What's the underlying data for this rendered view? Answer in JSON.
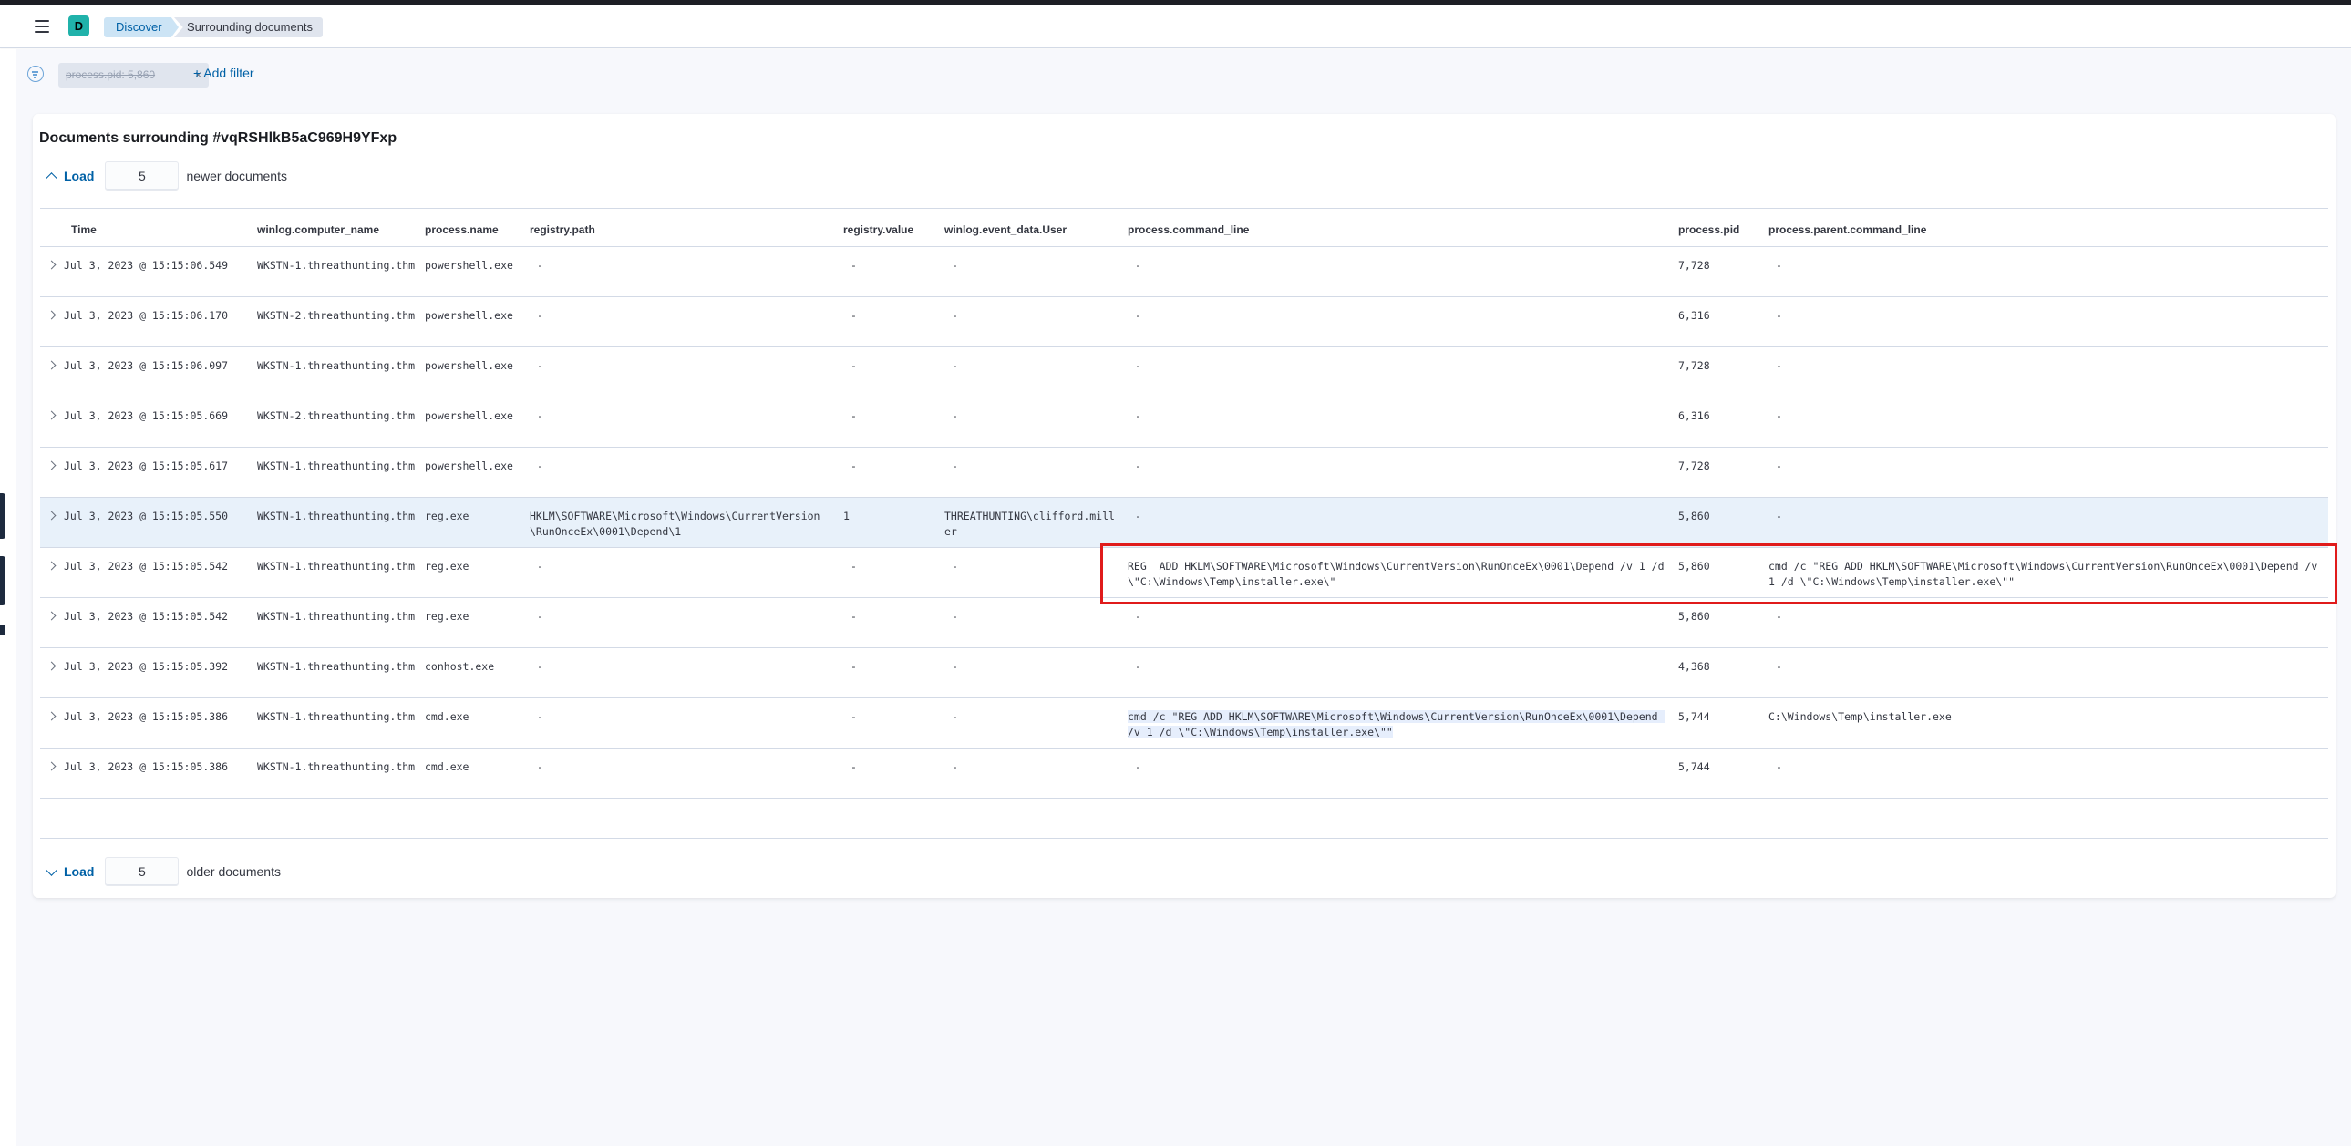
{
  "header": {
    "space_initial": "D",
    "breadcrumbs": [
      "Discover",
      "Surrounding documents"
    ]
  },
  "filters": {
    "pill": "process.pid: 5,860",
    "add_filter": "+ Add filter"
  },
  "panel": {
    "title": "Documents surrounding #vqRSHlkB5aC969H9YFxp",
    "newer": {
      "load": "Load",
      "count": "5",
      "label": "newer documents"
    },
    "older": {
      "load": "Load",
      "count": "5",
      "label": "older documents"
    }
  },
  "table": {
    "columns": [
      "Time",
      "winlog.computer_name",
      "process.name",
      "registry.path",
      "registry.value",
      "winlog.event_data.User",
      "process.command_line",
      "process.pid",
      "process.parent.command_line"
    ],
    "rows": [
      {
        "time": "Jul 3, 2023 @ 15:15:06.549",
        "computer": "WKSTN-1.threathunting.thm",
        "pname": "powershell.exe",
        "rpath": "-",
        "rvalue": "-",
        "user": "-",
        "cmd": "-",
        "pid": "7,728",
        "parent": "-"
      },
      {
        "time": "Jul 3, 2023 @ 15:15:06.170",
        "computer": "WKSTN-2.threathunting.thm",
        "pname": "powershell.exe",
        "rpath": "-",
        "rvalue": "-",
        "user": "-",
        "cmd": "-",
        "pid": "6,316",
        "parent": "-"
      },
      {
        "time": "Jul 3, 2023 @ 15:15:06.097",
        "computer": "WKSTN-1.threathunting.thm",
        "pname": "powershell.exe",
        "rpath": "-",
        "rvalue": "-",
        "user": "-",
        "cmd": "-",
        "pid": "7,728",
        "parent": "-"
      },
      {
        "time": "Jul 3, 2023 @ 15:15:05.669",
        "computer": "WKSTN-2.threathunting.thm",
        "pname": "powershell.exe",
        "rpath": "-",
        "rvalue": "-",
        "user": "-",
        "cmd": "-",
        "pid": "6,316",
        "parent": "-"
      },
      {
        "time": "Jul 3, 2023 @ 15:15:05.617",
        "computer": "WKSTN-1.threathunting.thm",
        "pname": "powershell.exe",
        "rpath": "-",
        "rvalue": "-",
        "user": "-",
        "cmd": "-",
        "pid": "7,728",
        "parent": "-"
      },
      {
        "time": "Jul 3, 2023 @ 15:15:05.550",
        "computer": "WKSTN-1.threathunting.thm",
        "pname": "reg.exe",
        "rpath": "HKLM\\SOFTWARE\\Microsoft\\Windows\\CurrentVersion\\RunOnceEx\\0001\\Depend\\1",
        "rvalue": "1",
        "user": "THREATHUNTING\\clifford.miller",
        "cmd": "-",
        "pid": "5,860",
        "parent": "-"
      },
      {
        "time": "Jul 3, 2023 @ 15:15:05.542",
        "computer": "WKSTN-1.threathunting.thm",
        "pname": "reg.exe",
        "rpath": "-",
        "rvalue": "-",
        "user": "-",
        "cmd": "REG  ADD HKLM\\SOFTWARE\\Microsoft\\Windows\\CurrentVersion\\RunOnceEx\\0001\\Depend /v 1 /d \\\"C:\\Windows\\Temp\\installer.exe\\\"",
        "pid": "5,860",
        "parent": "cmd /c \"REG ADD HKLM\\SOFTWARE\\Microsoft\\Windows\\CurrentVersion\\RunOnceEx\\0001\\Depend /v 1 /d \\\"C:\\Windows\\Temp\\installer.exe\\\"\""
      },
      {
        "time": "Jul 3, 2023 @ 15:15:05.542",
        "computer": "WKSTN-1.threathunting.thm",
        "pname": "reg.exe",
        "rpath": "-",
        "rvalue": "-",
        "user": "-",
        "cmd": "-",
        "pid": "5,860",
        "parent": "-"
      },
      {
        "time": "Jul 3, 2023 @ 15:15:05.392",
        "computer": "WKSTN-1.threathunting.thm",
        "pname": "conhost.exe",
        "rpath": "-",
        "rvalue": "-",
        "user": "-",
        "cmd": "-",
        "pid": "4,368",
        "parent": "-"
      },
      {
        "time": "Jul 3, 2023 @ 15:15:05.386",
        "computer": "WKSTN-1.threathunting.thm",
        "pname": "cmd.exe",
        "rpath": "-",
        "rvalue": "-",
        "user": "-",
        "cmd": "cmd /c \"REG ADD HKLM\\SOFTWARE\\Microsoft\\Windows\\CurrentVersion\\RunOnceEx\\0001\\Depend /v 1 /d \\\"C:\\Windows\\Temp\\installer.exe\\\"\"",
        "pid": "5,744",
        "parent": "C:\\Windows\\Temp\\installer.exe"
      },
      {
        "time": "Jul 3, 2023 @ 15:15:05.386",
        "computer": "WKSTN-1.threathunting.thm",
        "pname": "cmd.exe",
        "rpath": "-",
        "rvalue": "-",
        "user": "-",
        "cmd": "-",
        "pid": "5,744",
        "parent": "-"
      }
    ]
  },
  "colors": {
    "accent": "#0061a6",
    "highlight_row": "#e8f1fa",
    "annotation_box": "#e01b1b"
  }
}
